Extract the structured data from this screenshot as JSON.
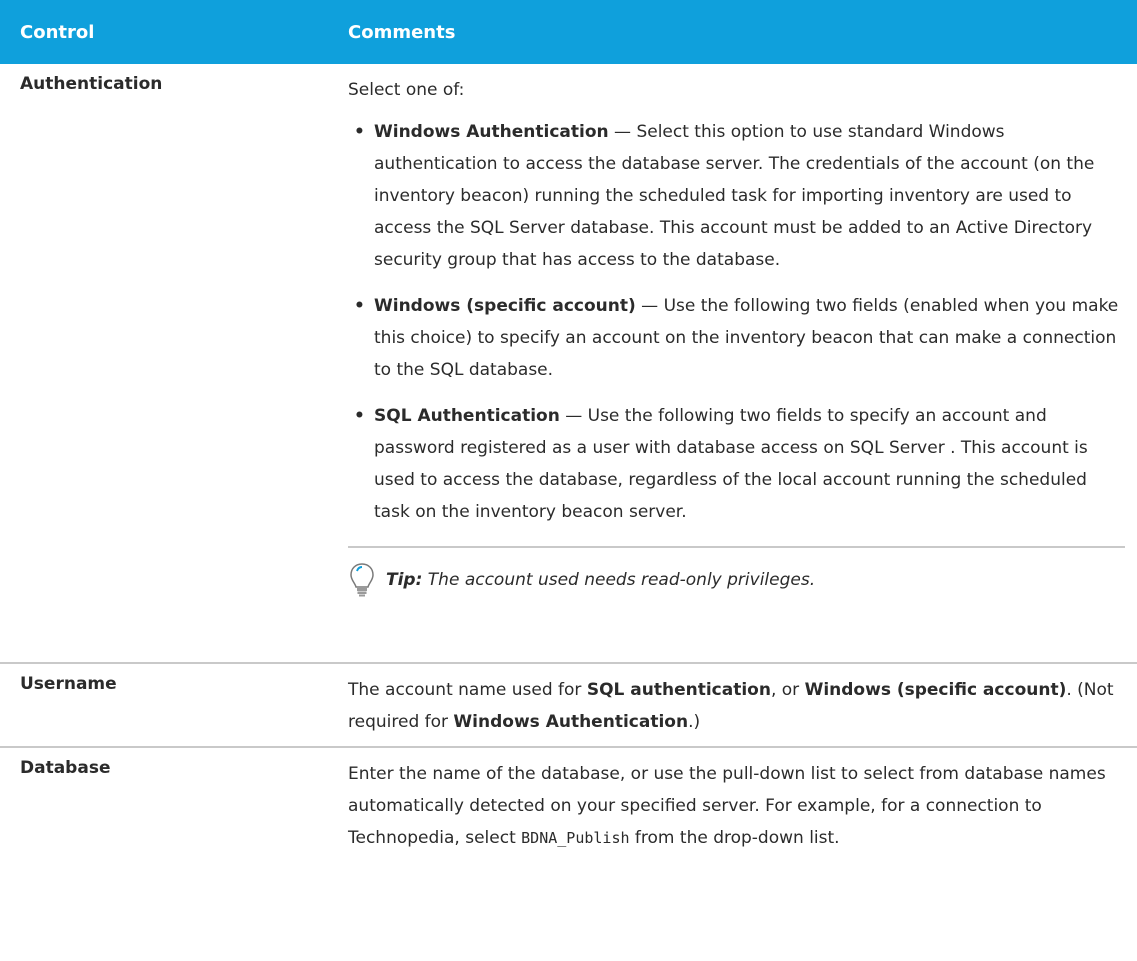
{
  "header": {
    "control": "Control",
    "comments": "Comments"
  },
  "rows": {
    "authentication": {
      "control": "Authentication",
      "intro": "Select one of:",
      "options": [
        {
          "title": "Windows Authentication",
          "text": " — Select this option to use standard Windows authentication to access the database server. The credentials of the account (on the inventory beacon) running the scheduled task for importing inventory are used to access the SQL Server database. This account must be added to an Active Directory security group that has access to the database."
        },
        {
          "title": "Windows (specific account)",
          "text": " — Use the following two fields (enabled when you make this choice) to specify an account on the inventory beacon that can make a connection to the SQL database."
        },
        {
          "title": "SQL Authentication",
          "text": " — Use the following two fields to specify an account and password registered as a user with database access on SQL Server . This account is used to access the database, regardless of the local account running the scheduled task on the inventory beacon server."
        }
      ],
      "tip": {
        "label": "Tip:",
        "text": " The account used needs read-only privileges."
      }
    },
    "username": {
      "control": "Username",
      "parts": {
        "p1": "The account name used for ",
        "b1": "SQL authentication",
        "p2": ", or ",
        "b2": "Windows (specific account)",
        "p3": ". (Not required for ",
        "b3": "Windows Authentication",
        "p4": ".)"
      }
    },
    "database": {
      "control": "Database",
      "parts": {
        "p1": "Enter the name of the database, or use the pull-down list to select from database names automatically detected on your specified server. For example, for a connection to Technopedia, select ",
        "code": "BDNA_Publish",
        "p2": " from the drop-down list."
      }
    }
  },
  "icons": {
    "tip": "lightbulb-icon"
  },
  "colors": {
    "header_bg": "#0fa0dc",
    "divider": "#c9c9c9"
  }
}
